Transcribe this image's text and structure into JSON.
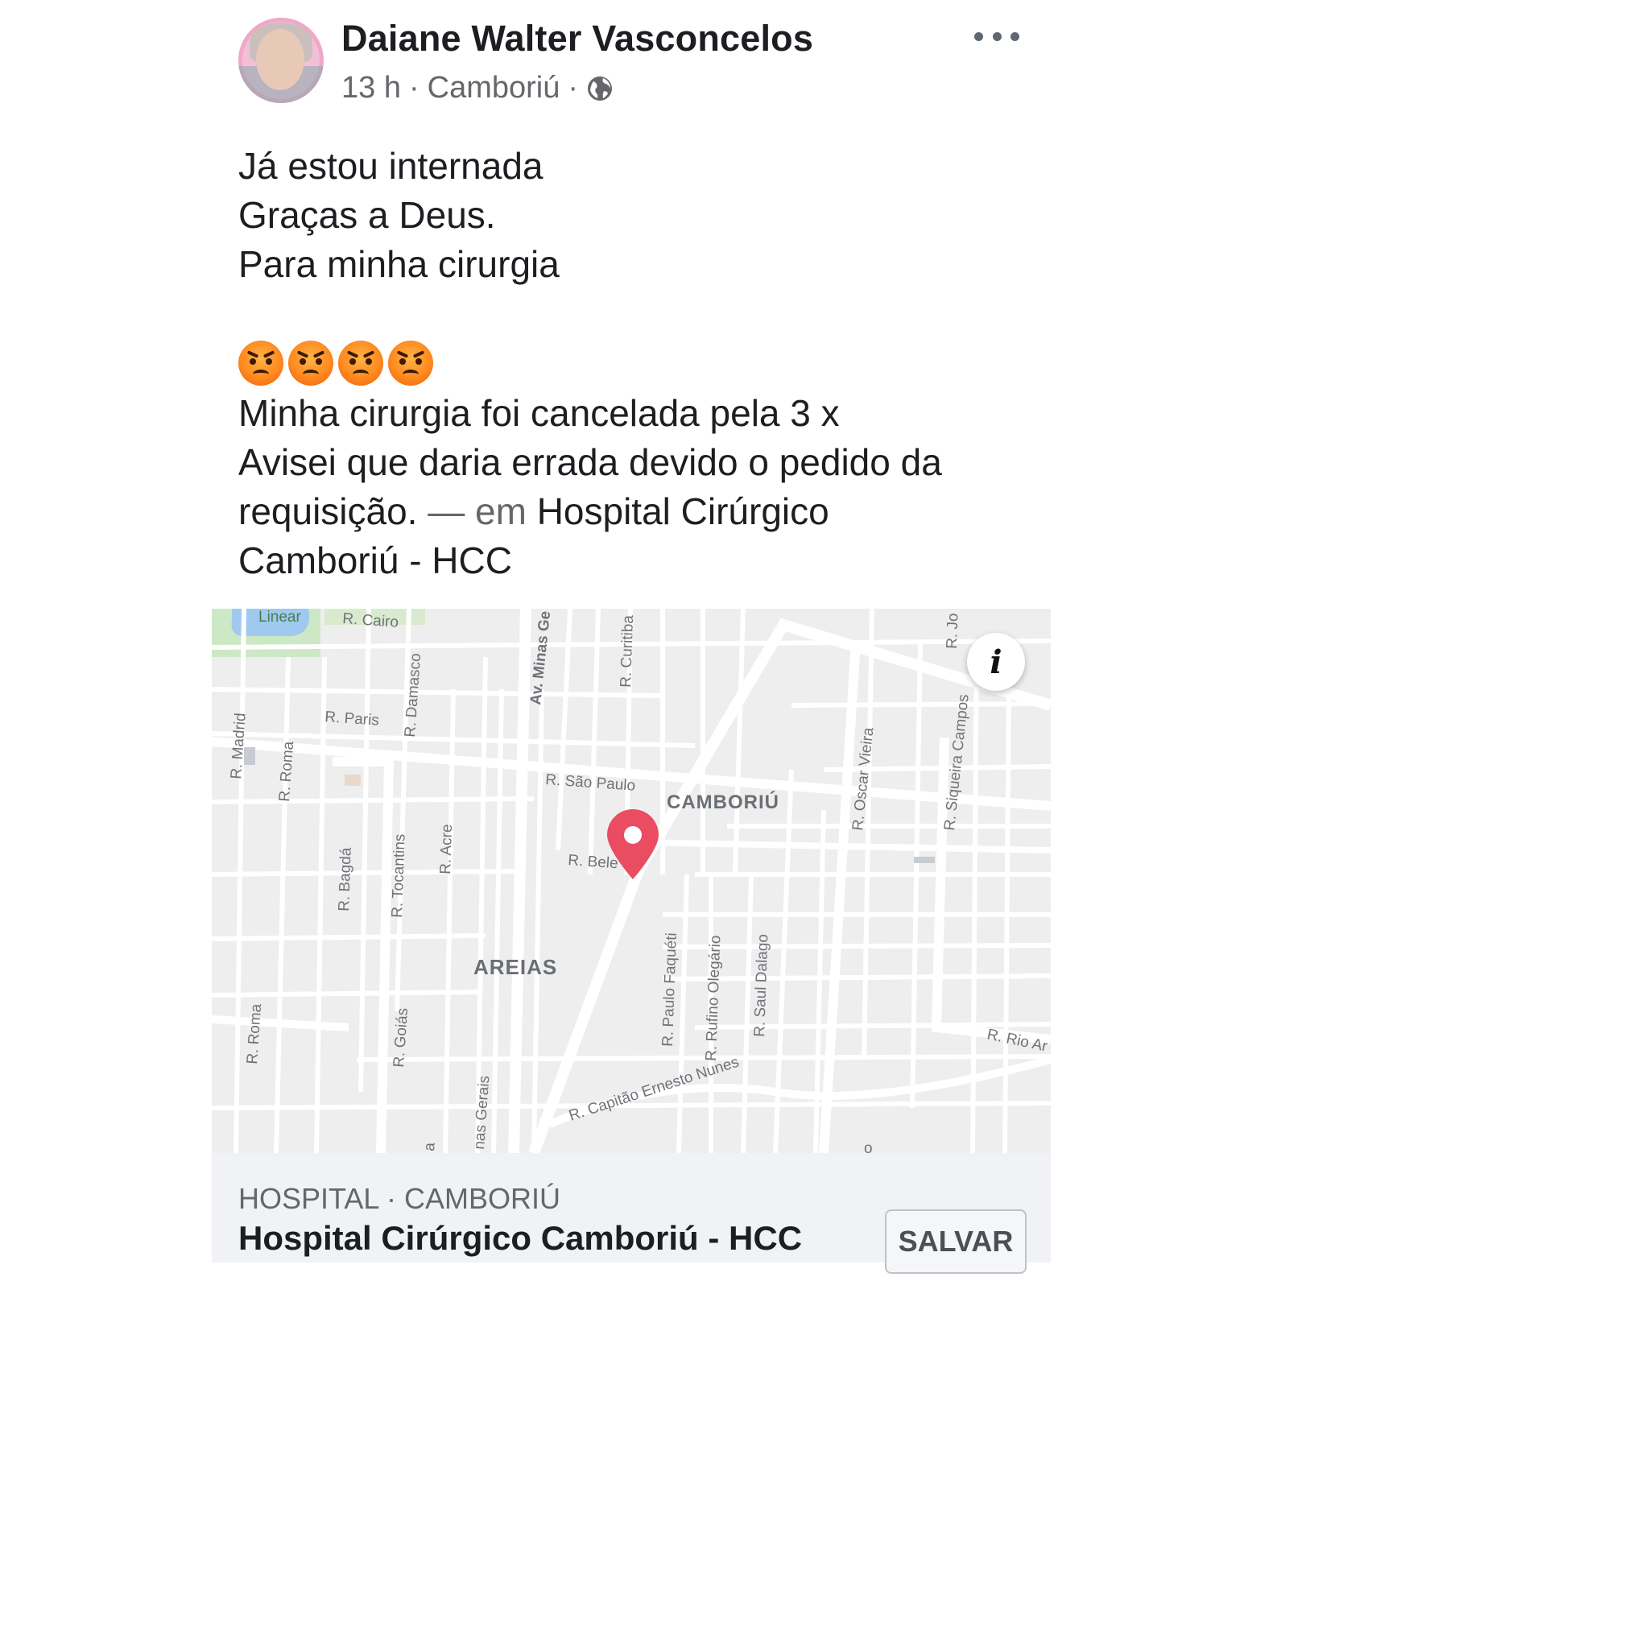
{
  "post": {
    "author": "Daiane Walter Vasconcelos",
    "time": "13 h",
    "location": "Camboriú",
    "separator": "·",
    "privacy_icon": "globe-icon",
    "more_icon": "more-options-icon",
    "lines": [
      "Já estou internada",
      "Graças a Deus.",
      "Para minha cirurgia"
    ],
    "emojis": [
      "angry-face",
      "angry-face",
      "angry-face",
      "angry-face"
    ],
    "body_line1": "Minha cirurgia  foi cancelada pela 3 x",
    "body_line2": "Avisei que daria errada devido o pedido da",
    "body_line3_start": "requisição.",
    "checkin_connector": "— em",
    "checkin_place_part1": "Hospital Cirúrgico",
    "checkin_place_part2": "Camboriú - HCC"
  },
  "map": {
    "info_icon": "info-icon",
    "pin_icon": "map-pin-icon",
    "pin_color": "#ea4c62",
    "labels": {
      "linear": "Linear",
      "cairo": "R. Cairo",
      "minas_gerais_top": "Av. Minas Ge",
      "curitiba": "R. Curitiba",
      "jo": "R. Jo",
      "damasco": "R. Damasco",
      "paris": "R. Paris",
      "madrid": "R. Madrid",
      "roma_top": "R. Roma",
      "sao_paulo": "R. São Paulo",
      "camboriu": "CAMBORIÚ",
      "oscar_vieira": "R. Oscar Vieira",
      "siqueira_campos": "R. Siqueira Campos",
      "bagda": "R. Bagdá",
      "tocantins": "R. Tocantins",
      "acre": "R. Acre",
      "belem": "R. Bele",
      "areias": "AREIAS",
      "paulo_faqueti": "R. Paulo Faquéti",
      "rufino_olegario": "R. Rufino Olegário",
      "saul_dalago": "R. Saul Dalago",
      "roma_bottom": "R. Roma",
      "goias": "R. Goiás",
      "rio": "R. Rio Ar",
      "capitao": "R. Capitão Ernesto Nunes",
      "minas_gerais_bottom": "nas Gerais",
      "frag_a": "a",
      "frag_o": "o"
    }
  },
  "place_card": {
    "category": "HOSPITAL · CAMBORIÚ",
    "name": "Hospital Cirúrgico Camboriú - HCC",
    "save_label": "SALVAR"
  }
}
